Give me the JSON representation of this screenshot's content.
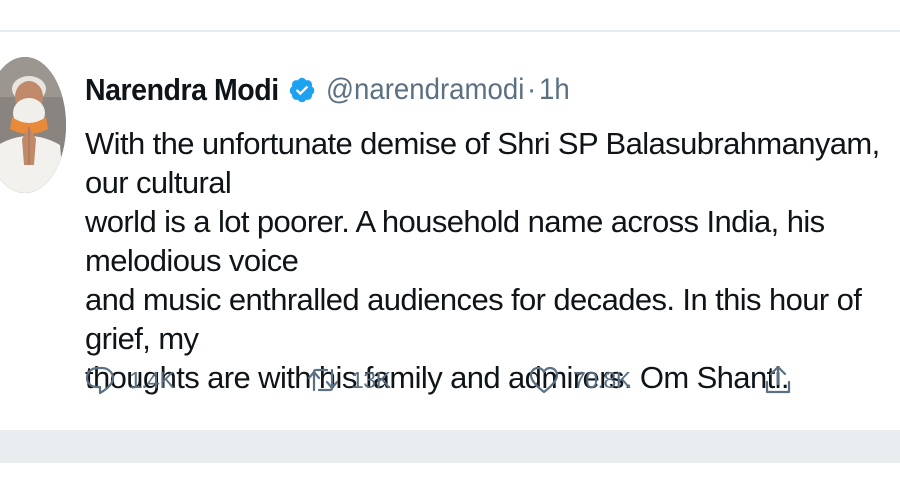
{
  "tweet": {
    "author": {
      "display_name": "Narendra Modi",
      "handle": "@narendramodi",
      "verified": true
    },
    "separator": "·",
    "time": "1h",
    "text": "With the unfortunate demise of Shri SP Balasubrahmanyam, our cultural\nworld is a lot poorer. A household name across India, his melodious voice\nand music enthralled audiences for decades. In this hour of grief, my\nthoughts are with his family and admirers. Om Shanti.",
    "actions": {
      "reply_count": "1.4K",
      "retweet_count": "13K",
      "like_count": "70.8K"
    }
  },
  "icons": {
    "verified": "verified-badge-icon",
    "reply": "speech-bubble-icon",
    "retweet": "retweet-arrows-icon",
    "like": "heart-icon",
    "share": "share-upload-icon"
  },
  "colors": {
    "text_primary": "#0f1419",
    "text_secondary": "#5b7083",
    "verified_blue": "#1da1f2",
    "divider": "#e6ecf0",
    "bottom_band": "#e9edf0"
  }
}
